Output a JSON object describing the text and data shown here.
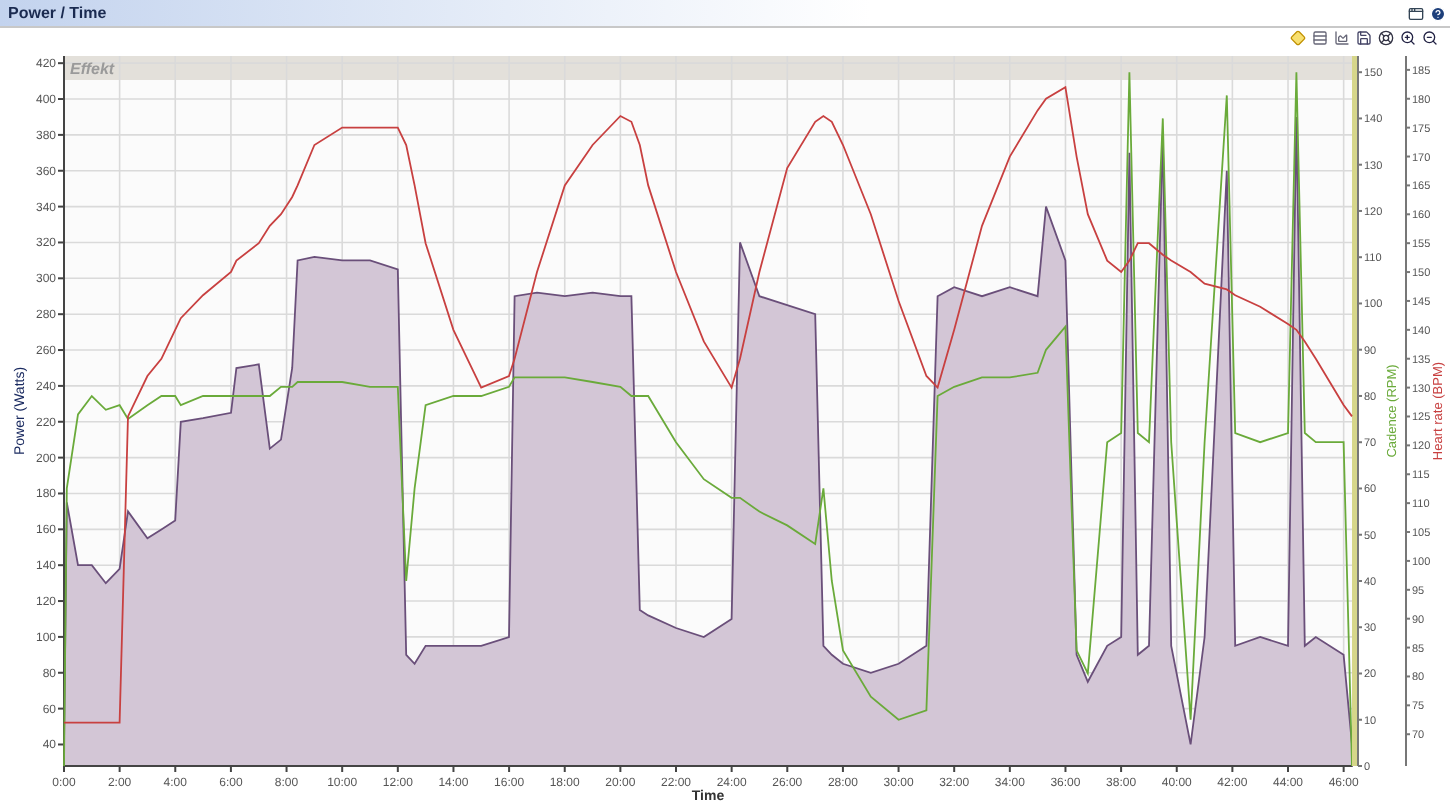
{
  "window": {
    "title": "Power / Time"
  },
  "power_chart": {
    "panel_label": "Effekt",
    "chart_data": {
      "type": "area",
      "xlabel": "Time",
      "ylabel": "Power (Watts)",
      "grid": true,
      "xlim": [
        0,
        46.3
      ],
      "ylim": [
        28,
        424
      ],
      "xticks": [
        {
          "value": 0,
          "label": "0:00"
        },
        {
          "value": 2,
          "label": "2:00"
        },
        {
          "value": 4,
          "label": "4:00"
        },
        {
          "value": 6,
          "label": "6:00"
        },
        {
          "value": 8,
          "label": "8:00"
        },
        {
          "value": 10,
          "label": "10:00"
        },
        {
          "value": 12,
          "label": "12:00"
        },
        {
          "value": 14,
          "label": "14:00"
        },
        {
          "value": 16,
          "label": "16:00"
        },
        {
          "value": 18,
          "label": "18:00"
        },
        {
          "value": 20,
          "label": "20:00"
        },
        {
          "value": 22,
          "label": "22:00"
        },
        {
          "value": 24,
          "label": "24:00"
        },
        {
          "value": 26,
          "label": "26:00"
        },
        {
          "value": 28,
          "label": "28:00"
        },
        {
          "value": 30,
          "label": "30:00"
        },
        {
          "value": 32,
          "label": "32:00"
        },
        {
          "value": 34,
          "label": "34:00"
        },
        {
          "value": 36,
          "label": "36:00"
        },
        {
          "value": 38,
          "label": "38:00"
        },
        {
          "value": 40,
          "label": "40:00"
        },
        {
          "value": 42,
          "label": "42:00"
        },
        {
          "value": 44,
          "label": "44:00"
        },
        {
          "value": 46,
          "label": "46:00"
        }
      ],
      "yticks": [
        40,
        60,
        80,
        100,
        120,
        140,
        160,
        180,
        200,
        220,
        240,
        260,
        280,
        300,
        320,
        340,
        360,
        380,
        400,
        420
      ],
      "x": [
        0,
        0.1,
        0.5,
        1,
        1.5,
        2,
        2.3,
        3,
        3.5,
        4,
        4.2,
        5,
        6,
        6.2,
        7,
        7.4,
        7.8,
        8.2,
        8.4,
        9,
        10,
        11,
        12,
        12.3,
        12.6,
        13,
        14,
        15,
        16,
        16.2,
        17,
        18,
        19,
        20,
        20.4,
        20.7,
        21,
        22,
        23,
        24,
        24.3,
        25,
        26,
        27,
        27.3,
        27.6,
        28,
        29,
        30,
        31,
        31.4,
        32,
        33,
        34,
        35,
        35.3,
        36,
        36.4,
        36.8,
        37.5,
        38,
        38.3,
        38.6,
        39,
        39.5,
        39.8,
        40.5,
        41,
        41.8,
        42.1,
        43,
        44,
        44.3,
        44.6,
        45,
        46,
        46.3
      ],
      "series": [
        {
          "color": "#6a4f7a",
          "values": [
            40,
            175,
            140,
            140,
            130,
            138,
            170,
            155,
            160,
            165,
            220,
            222,
            225,
            250,
            252,
            205,
            210,
            250,
            310,
            312,
            310,
            310,
            305,
            90,
            85,
            95,
            95,
            95,
            100,
            290,
            292,
            290,
            292,
            290,
            290,
            115,
            112,
            105,
            100,
            110,
            320,
            290,
            285,
            280,
            95,
            90,
            85,
            80,
            85,
            95,
            290,
            295,
            290,
            295,
            290,
            340,
            310,
            90,
            75,
            95,
            100,
            370,
            90,
            95,
            380,
            95,
            40,
            100,
            360,
            95,
            100,
            95,
            390,
            95,
            100,
            90,
            40
          ]
        }
      ]
    }
  },
  "cadence_chart": {
    "chart_data": {
      "type": "line",
      "ylabel": "Cadence (RPM)",
      "xlim": [
        0,
        46.3
      ],
      "ylim": [
        0,
        153.5
      ],
      "yticks": [
        0,
        10,
        20,
        30,
        40,
        50,
        60,
        70,
        80,
        90,
        100,
        110,
        120,
        130,
        140,
        150
      ],
      "x": [
        0,
        0.1,
        0.5,
        1,
        1.5,
        2,
        2.3,
        3,
        3.5,
        4,
        4.2,
        5,
        6,
        6.2,
        7,
        7.4,
        7.8,
        8.2,
        8.4,
        9,
        10,
        11,
        12,
        12.3,
        12.6,
        13,
        14,
        15,
        16,
        16.2,
        17,
        18,
        19,
        20,
        20.4,
        20.7,
        21,
        22,
        23,
        24,
        24.3,
        25,
        26,
        27,
        27.3,
        27.6,
        28,
        29,
        30,
        31,
        31.4,
        32,
        33,
        34,
        35,
        35.3,
        36,
        36.4,
        36.8,
        37.5,
        38,
        38.3,
        38.6,
        39,
        39.5,
        39.8,
        40.5,
        41,
        41.8,
        42.1,
        43,
        44,
        44.3,
        44.6,
        45,
        46,
        46.3
      ],
      "series": [
        {
          "color": "#6aaa3a",
          "values": [
            0,
            60,
            76,
            80,
            77,
            78,
            75,
            78,
            80,
            80,
            78,
            80,
            80,
            80,
            80,
            80,
            82,
            82,
            83,
            83,
            83,
            82,
            82,
            40,
            60,
            78,
            80,
            80,
            82,
            84,
            84,
            84,
            83,
            82,
            80,
            80,
            80,
            70,
            62,
            58,
            58,
            55,
            52,
            48,
            60,
            40,
            25,
            15,
            10,
            12,
            80,
            82,
            84,
            84,
            85,
            90,
            95,
            25,
            20,
            70,
            72,
            150,
            72,
            70,
            140,
            70,
            10,
            70,
            145,
            72,
            70,
            72,
            150,
            72,
            70,
            70,
            0
          ]
        }
      ]
    }
  },
  "heart_rate_chart": {
    "chart_data": {
      "type": "line",
      "ylabel": "Heart rate (BPM)",
      "xlim": [
        0,
        46.3
      ],
      "ylim": [
        64.5,
        187.4
      ],
      "yticks": [
        70,
        75,
        80,
        85,
        90,
        95,
        100,
        105,
        110,
        115,
        120,
        125,
        130,
        135,
        140,
        145,
        150,
        155,
        160,
        165,
        170,
        175,
        180,
        185
      ],
      "x": [
        0,
        0.1,
        0.5,
        1,
        1.5,
        2,
        2.3,
        3,
        3.5,
        4,
        4.2,
        5,
        6,
        6.2,
        7,
        7.4,
        7.8,
        8.2,
        8.4,
        9,
        10,
        11,
        12,
        12.3,
        12.6,
        13,
        14,
        15,
        16,
        16.2,
        17,
        18,
        19,
        20,
        20.4,
        20.7,
        21,
        22,
        23,
        24,
        24.3,
        25,
        26,
        27,
        27.3,
        27.6,
        28,
        29,
        30,
        31,
        31.4,
        32,
        33,
        34,
        35,
        35.3,
        36,
        36.4,
        36.8,
        37.5,
        38,
        38.3,
        38.6,
        39,
        39.5,
        39.8,
        40.5,
        41,
        41.8,
        42.1,
        43,
        44,
        44.3,
        44.6,
        45,
        46,
        46.3
      ],
      "series": [
        {
          "color": "#c84040",
          "values": [
            72,
            72,
            72,
            72,
            72,
            72,
            125,
            132,
            135,
            140,
            142,
            146,
            150,
            152,
            155,
            158,
            160,
            163,
            165,
            172,
            175,
            175,
            175,
            172,
            165,
            155,
            140,
            130,
            132,
            135,
            150,
            165,
            172,
            177,
            176,
            172,
            165,
            150,
            138,
            130,
            135,
            150,
            168,
            176,
            177,
            176,
            172,
            160,
            145,
            132,
            130,
            140,
            158,
            170,
            178,
            180,
            182,
            170,
            160,
            152,
            150,
            152,
            155,
            155,
            153,
            152,
            150,
            148,
            147,
            146,
            144,
            141,
            140,
            138,
            135,
            127,
            125
          ]
        }
      ]
    }
  }
}
